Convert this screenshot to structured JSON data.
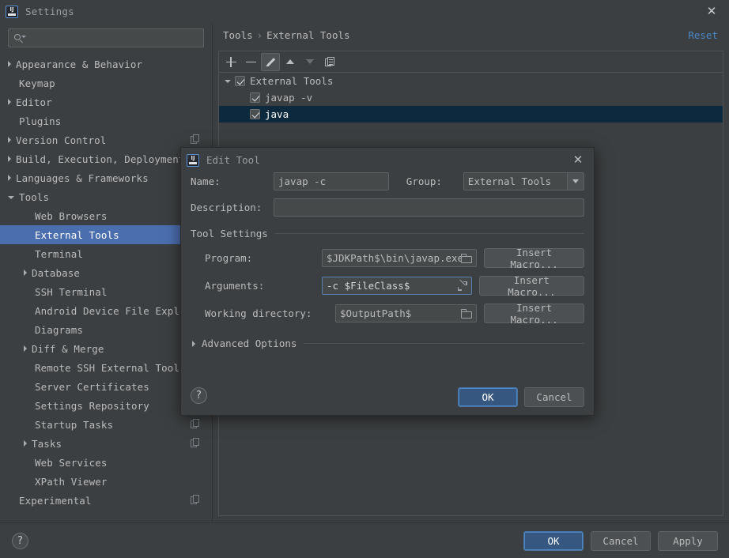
{
  "window": {
    "title": "Settings",
    "logo_icon": "intellij-logo-icon",
    "close_icon": "close-icon"
  },
  "search": {
    "placeholder": "",
    "value": "",
    "icon": "search-icon"
  },
  "sidebar": {
    "items": [
      {
        "label": "Appearance & Behavior",
        "arrow": "collapsed",
        "indent": 0,
        "selected": false,
        "sync": false
      },
      {
        "label": "Keymap",
        "arrow": "none",
        "indent": 0,
        "selected": false,
        "sync": false
      },
      {
        "label": "Editor",
        "arrow": "collapsed",
        "indent": 0,
        "selected": false,
        "sync": false
      },
      {
        "label": "Plugins",
        "arrow": "none",
        "indent": 0,
        "selected": false,
        "sync": false
      },
      {
        "label": "Version Control",
        "arrow": "collapsed",
        "indent": 0,
        "selected": false,
        "sync": true
      },
      {
        "label": "Build, Execution, Deployment",
        "arrow": "collapsed",
        "indent": 0,
        "selected": false,
        "sync": false
      },
      {
        "label": "Languages & Frameworks",
        "arrow": "collapsed",
        "indent": 0,
        "selected": false,
        "sync": false
      },
      {
        "label": "Tools",
        "arrow": "expanded",
        "indent": 0,
        "selected": false,
        "sync": false
      },
      {
        "label": "Web Browsers",
        "arrow": "none",
        "indent": 1,
        "selected": false,
        "sync": false
      },
      {
        "label": "External Tools",
        "arrow": "none",
        "indent": 1,
        "selected": true,
        "sync": false
      },
      {
        "label": "Terminal",
        "arrow": "none",
        "indent": 1,
        "selected": false,
        "sync": false
      },
      {
        "label": "Database",
        "arrow": "collapsed",
        "indent": 1,
        "selected": false,
        "sync": false
      },
      {
        "label": "SSH Terminal",
        "arrow": "none",
        "indent": 1,
        "selected": false,
        "sync": false
      },
      {
        "label": "Android Device File Explorer",
        "arrow": "none",
        "indent": 1,
        "selected": false,
        "sync": false
      },
      {
        "label": "Diagrams",
        "arrow": "none",
        "indent": 1,
        "selected": false,
        "sync": false
      },
      {
        "label": "Diff & Merge",
        "arrow": "collapsed",
        "indent": 1,
        "selected": false,
        "sync": false
      },
      {
        "label": "Remote SSH External Tools",
        "arrow": "none",
        "indent": 1,
        "selected": false,
        "sync": false
      },
      {
        "label": "Server Certificates",
        "arrow": "none",
        "indent": 1,
        "selected": false,
        "sync": false
      },
      {
        "label": "Settings Repository",
        "arrow": "none",
        "indent": 1,
        "selected": false,
        "sync": false
      },
      {
        "label": "Startup Tasks",
        "arrow": "none",
        "indent": 1,
        "selected": false,
        "sync": true
      },
      {
        "label": "Tasks",
        "arrow": "collapsed",
        "indent": 1,
        "selected": false,
        "sync": true
      },
      {
        "label": "Web Services",
        "arrow": "none",
        "indent": 1,
        "selected": false,
        "sync": false
      },
      {
        "label": "XPath Viewer",
        "arrow": "none",
        "indent": 1,
        "selected": false,
        "sync": false
      },
      {
        "label": "Experimental",
        "arrow": "none",
        "indent": 0,
        "selected": false,
        "sync": true
      }
    ]
  },
  "content": {
    "breadcrumb": {
      "root": "Tools",
      "separator": "›",
      "leaf": "External Tools"
    },
    "reset_label": "Reset",
    "toolbar": [
      {
        "name": "add-button",
        "icon": "plus-icon",
        "enabled": true,
        "active": false
      },
      {
        "name": "remove-button",
        "icon": "minus-icon",
        "enabled": true,
        "active": false
      },
      {
        "name": "edit-button",
        "icon": "pencil-icon",
        "enabled": true,
        "active": true
      },
      {
        "name": "move-up-button",
        "icon": "arrow-up-icon",
        "enabled": true,
        "active": false
      },
      {
        "name": "move-down-button",
        "icon": "arrow-down-icon",
        "enabled": false,
        "active": false
      },
      {
        "name": "copy-button",
        "icon": "copy-icon",
        "enabled": true,
        "active": false
      }
    ],
    "tools_tree": [
      {
        "label": "External Tools",
        "level": 0,
        "checked": true,
        "expanded": true,
        "selected": false
      },
      {
        "label": "javap -v",
        "level": 1,
        "checked": true,
        "expanded": null,
        "selected": false
      },
      {
        "label": "java",
        "level": 1,
        "checked": true,
        "expanded": null,
        "selected": true
      }
    ]
  },
  "dialog": {
    "title": "Edit Tool",
    "logo_icon": "intellij-logo-icon",
    "close_icon": "close-icon",
    "name_label": "Name:",
    "name_value": "javap -c",
    "group_label": "Group:",
    "group_value": "External Tools",
    "description_label": "Description:",
    "description_value": "",
    "description_placeholder": "",
    "tool_settings_label": "Tool Settings",
    "program_label": "Program:",
    "program_value": "$JDKPath$\\bin\\javap.exe",
    "arguments_label": "Arguments:",
    "arguments_value": "-c $FileClass$",
    "working_directory_label": "Working directory:",
    "working_directory_value": "$OutputPath$",
    "insert_macro_label": "Insert Macro...",
    "advanced_options_label": "Advanced Options",
    "help_label": "?",
    "ok_label": "OK",
    "cancel_label": "Cancel"
  },
  "footer": {
    "help_label": "?",
    "ok_label": "OK",
    "cancel_label": "Cancel",
    "apply_label": "Apply"
  },
  "colors": {
    "background": "#3c3f41",
    "selection": "#4b6eaf",
    "selection_inactive": "#0d293e",
    "accent_link": "#4a88c7",
    "primary_button": "#365880",
    "field_background": "#45494a",
    "text": "#bbbbbb"
  }
}
